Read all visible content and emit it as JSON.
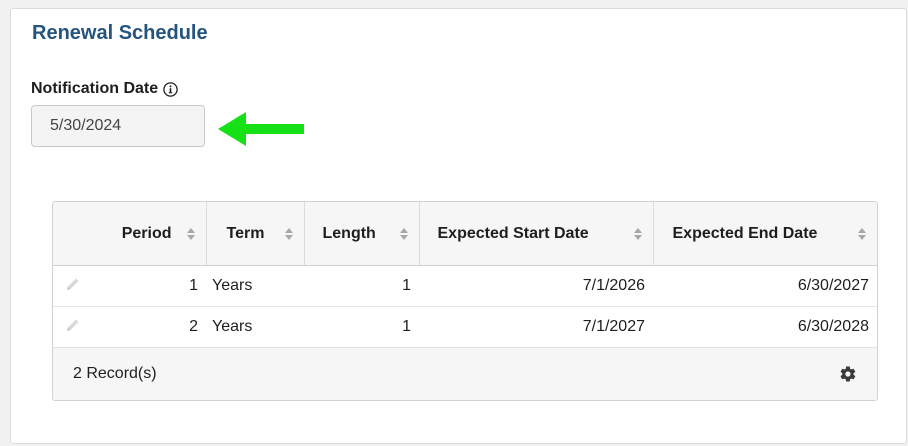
{
  "section": {
    "title": "Renewal Schedule"
  },
  "notification": {
    "label": "Notification Date",
    "value": "5/30/2024"
  },
  "table": {
    "columns": [
      {
        "label": "Period"
      },
      {
        "label": "Term"
      },
      {
        "label": "Length"
      },
      {
        "label": "Expected Start Date"
      },
      {
        "label": "Expected End Date"
      }
    ],
    "rows": [
      {
        "period": "1",
        "term": "Years",
        "length": "1",
        "start": "7/1/2026",
        "end": "6/30/2027"
      },
      {
        "period": "2",
        "term": "Years",
        "length": "1",
        "start": "7/1/2027",
        "end": "6/30/2028"
      }
    ],
    "footer_count": "2 Record(s)"
  },
  "colors": {
    "title": "#25557e",
    "annotation_arrow": "#16e016"
  },
  "icons": {
    "info": "info-icon",
    "sort": "sort-icon",
    "edit": "pencil-icon",
    "settings": "gear-icon",
    "annotation": "arrow-left-icon"
  }
}
